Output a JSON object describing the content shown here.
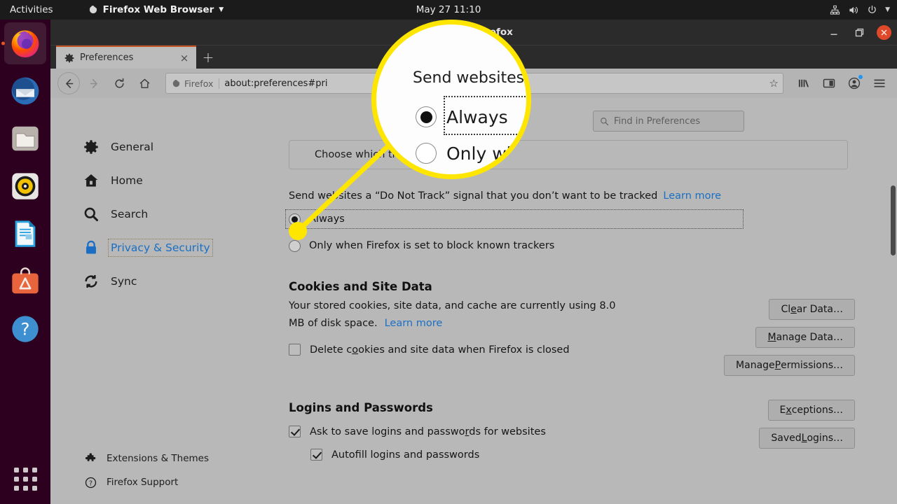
{
  "topbar": {
    "activities": "Activities",
    "app_menu": "Firefox Web Browser",
    "clock": "May 27  11:10",
    "icons": [
      "network-icon",
      "volume-icon",
      "power-icon",
      "chevron-down-icon"
    ]
  },
  "dock": {
    "items": [
      {
        "name": "firefox",
        "label": "Firefox Web Browser",
        "active": true
      },
      {
        "name": "thunderbird",
        "label": "Thunderbird Mail",
        "active": false
      },
      {
        "name": "files",
        "label": "Files",
        "active": false
      },
      {
        "name": "rhythmbox",
        "label": "Rhythmbox",
        "active": false
      },
      {
        "name": "libreoffice-writer",
        "label": "LibreOffice Writer",
        "active": false
      },
      {
        "name": "ubuntu-software",
        "label": "Ubuntu Software",
        "active": false
      },
      {
        "name": "help",
        "label": "Help",
        "active": false
      }
    ],
    "show_apps": "Show Applications"
  },
  "window": {
    "title": "Mozilla Firefox",
    "title_visible_fragment": "a Firefox",
    "minimize": "Minimize",
    "maximize": "Restore",
    "close": "Close"
  },
  "tabs": {
    "items": [
      {
        "title": "Preferences",
        "icon": "gear-icon",
        "close": "×"
      }
    ],
    "new_tab": "+"
  },
  "navbar": {
    "back": "←",
    "forward": "→",
    "reload": "↻",
    "home": "⌂",
    "identity_label": "Firefox",
    "url": "about:preferences#pri",
    "url_full": "about:preferences#privacy",
    "bookmark_star": "☆",
    "library": "library-icon",
    "sidebar": "sidebar-icon",
    "account": "account-icon",
    "menu": "hamburger-menu-icon"
  },
  "sidebar": {
    "items": [
      {
        "label": "General",
        "icon": "gear-icon",
        "selected": false
      },
      {
        "label": "Home",
        "icon": "home-icon",
        "selected": false
      },
      {
        "label": "Search",
        "icon": "search-icon",
        "selected": false
      },
      {
        "label": "Privacy & Security",
        "icon": "lock-icon",
        "selected": true
      },
      {
        "label": "Sync",
        "icon": "sync-icon",
        "selected": false
      }
    ],
    "bottom_items": [
      {
        "label": "Extensions & Themes",
        "icon": "puzzle-icon"
      },
      {
        "label": "Firefox Support",
        "icon": "help-circle-icon"
      }
    ]
  },
  "search": {
    "placeholder": "Find in Preferences",
    "icon": "search-icon"
  },
  "main": {
    "tracker_box_text": "Choose which trackers and",
    "dnt_text": "Send websites a “Do Not Track” signal that you don’t want to be tracked",
    "dnt_learn_more": "Learn more",
    "dnt_options": [
      {
        "label": "Always",
        "selected": true,
        "focused": true
      },
      {
        "label": "Only when Firefox is set to block known trackers",
        "selected": false,
        "focused": false
      }
    ],
    "cookies": {
      "title": "Cookies and Site Data",
      "desc_line1": "Your stored cookies, site data, and cache are currently using 8.0",
      "desc_line2": "MB of disk space.",
      "learn_more": "Learn more",
      "usage_value": "8.0 MB",
      "checkbox": {
        "label": "Delete cookies and site data when Firefox is closed",
        "checked": false
      },
      "buttons": [
        "Clear Data…",
        "Manage Data…",
        "Manage Permissions…"
      ]
    },
    "logins": {
      "title": "Logins and Passwords",
      "checkboxes": [
        {
          "label": "Ask to save logins and passwords for websites",
          "checked": true,
          "indent": false
        },
        {
          "label": "Autofill logins and passwords",
          "checked": true,
          "indent": true
        }
      ],
      "buttons": [
        "Exceptions…",
        "Saved Logins…"
      ]
    }
  },
  "magnifier": {
    "title": "Send websites",
    "options": [
      {
        "label": "Always",
        "selected": true
      },
      {
        "label": "Only whe",
        "selected": false
      }
    ],
    "ring_color": "#ffe600"
  },
  "colors": {
    "accent_link": "#1a6fc4",
    "ubuntu_purple": "#2c001e",
    "ubuntu_orange": "#e95420",
    "highlight_yellow": "#ffe600",
    "window_chrome": "#2b2b2b",
    "page_bg": "#b8b8b8"
  }
}
